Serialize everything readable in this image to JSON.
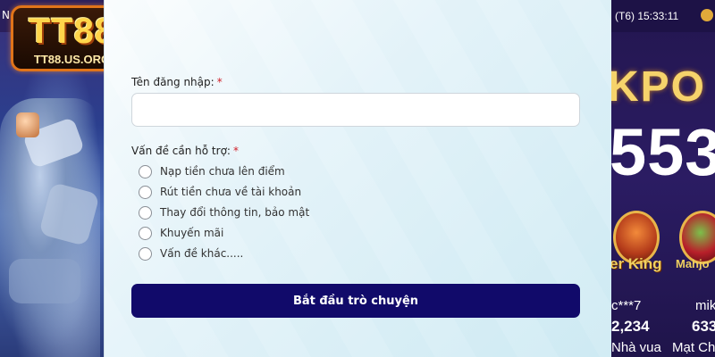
{
  "logo": {
    "brand": "TT88",
    "domain": "TT88.US.ORG"
  },
  "left_bg": {
    "topbar_text": "N"
  },
  "right_bg": {
    "time": "(T6) 15:33:11",
    "jackpot_text": "KPO",
    "jackpot_number": "553",
    "games": [
      {
        "name": "er King",
        "user": "c***7",
        "amount": "2,234",
        "label": "Nhà vua"
      },
      {
        "name": "Mahjo",
        "user": "mik",
        "amount": "633",
        "label": "Mạt Ch"
      }
    ]
  },
  "form": {
    "username_label": "Tên đăng nhập:",
    "required_mark": "*",
    "username_value": "",
    "username_placeholder": "",
    "issue_label": "Vấn đề cần hỗ trợ:",
    "options": [
      {
        "label": "Nạp tiền chưa lên điểm",
        "checked": false
      },
      {
        "label": "Rút tiền chưa về tài khoản",
        "checked": false
      },
      {
        "label": "Thay đổi thông tin, bảo mật",
        "checked": false
      },
      {
        "label": "Khuyến mãi",
        "checked": false
      },
      {
        "label": "Vấn đề khác.....",
        "checked": false
      }
    ],
    "submit_label": "Bắt đầu trò chuyện"
  },
  "colors": {
    "submit_bg": "#110a6a",
    "required": "#d0202a",
    "logo_border": "#e0741a"
  }
}
